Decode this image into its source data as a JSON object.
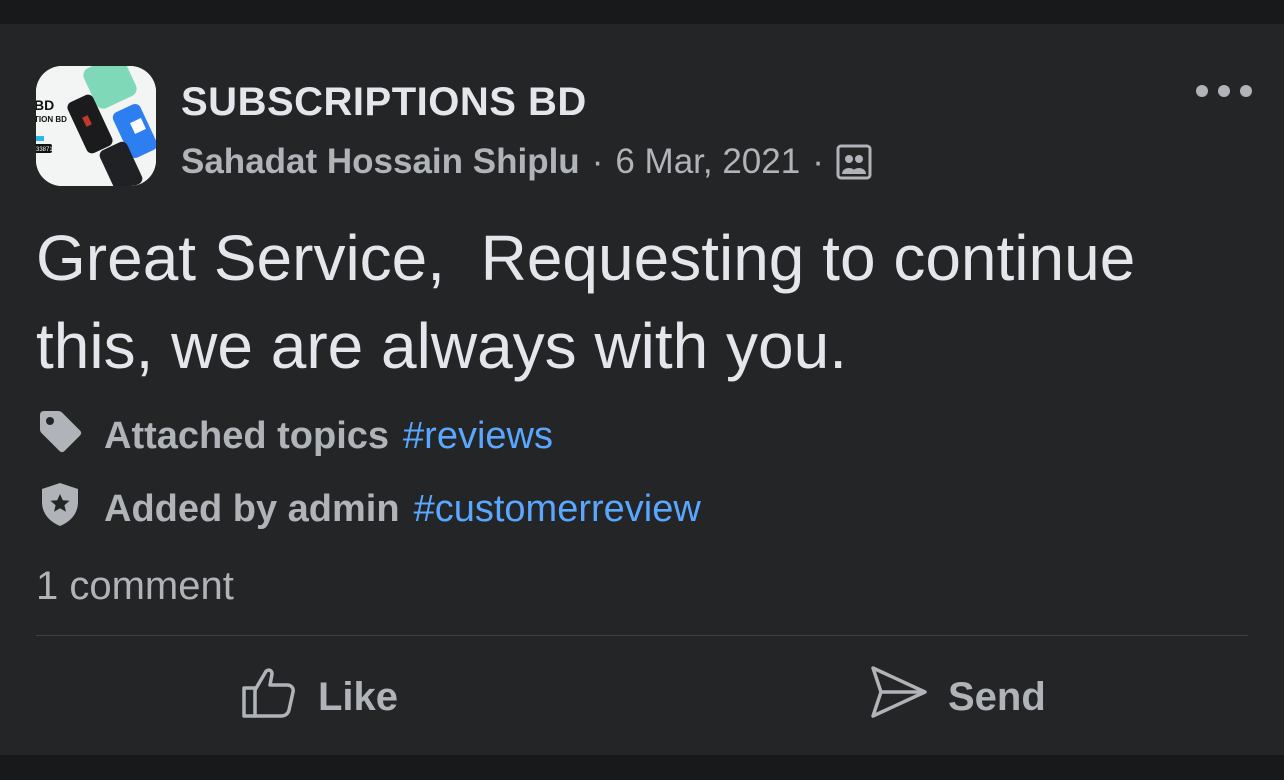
{
  "post": {
    "page_name": "SUBSCRIPTIONS BD",
    "author": "Sahadat Hossain Shiplu",
    "separator": "·",
    "date": "6 Mar, 2021",
    "audience_icon": "group-audience-icon",
    "more_icon": "more-options-icon",
    "text": "Great Service,  Requesting to continue this, we are always with you.",
    "avatar_text": {
      "line1": "BD",
      "line2": "TION BD",
      "line3": "33871"
    }
  },
  "topics": [
    {
      "icon": "tag-icon",
      "label": "Attached topics",
      "tag": "#reviews"
    },
    {
      "icon": "admin-shield-icon",
      "label": "Added by admin",
      "tag": "#customerreview"
    }
  ],
  "comments_label": "1 comment",
  "actions": {
    "like_label": "Like",
    "like_icon": "thumbs-up-icon",
    "send_label": "Send",
    "send_icon": "send-icon"
  },
  "colors": {
    "background": "#18191b",
    "card": "#242527",
    "primary_text": "#e4e6eb",
    "secondary_text": "#b0b3b8",
    "hashtag": "#5aa7ff"
  }
}
